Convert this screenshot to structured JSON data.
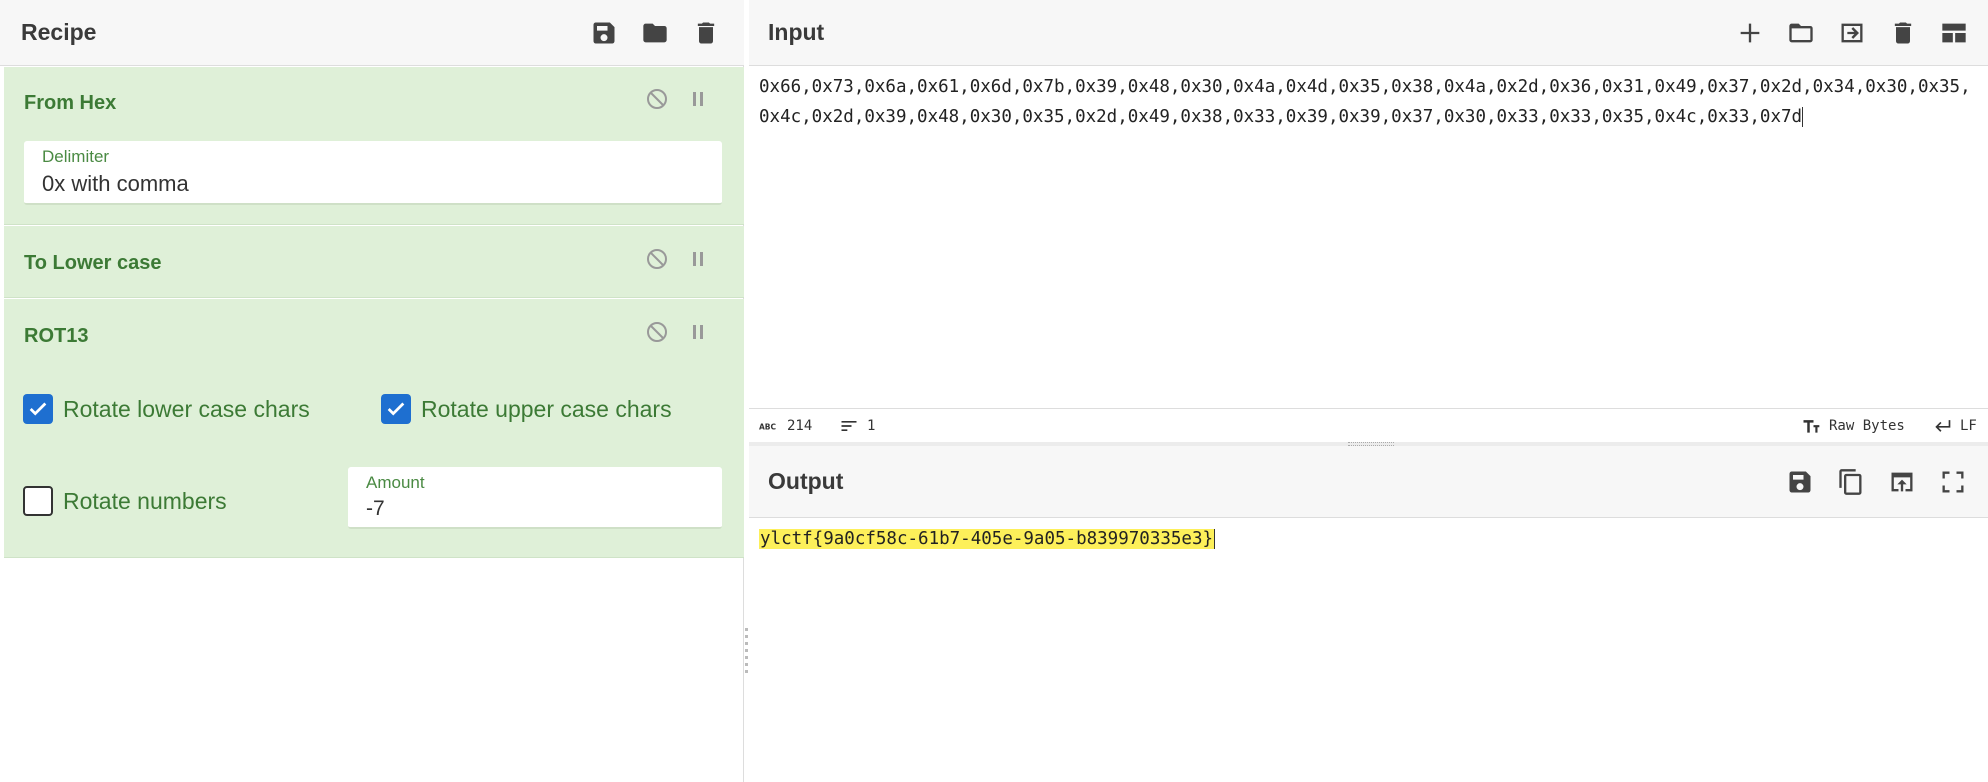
{
  "recipe": {
    "title": "Recipe",
    "icons": [
      "save-icon",
      "folder-icon",
      "trash-icon"
    ],
    "operations": {
      "from_hex": {
        "title": "From Hex",
        "delimiter_label": "Delimiter",
        "delimiter_value": "0x with comma"
      },
      "to_lower": {
        "title": "To Lower case"
      },
      "rot13": {
        "title": "ROT13",
        "rotate_lower_label": "Rotate lower case chars",
        "rotate_lower_checked": true,
        "rotate_upper_label": "Rotate upper case chars",
        "rotate_upper_checked": true,
        "rotate_numbers_label": "Rotate numbers",
        "rotate_numbers_checked": false,
        "amount_label": "Amount",
        "amount_value": "-7"
      }
    }
  },
  "input": {
    "title": "Input",
    "icons": [
      "plus-icon",
      "folder-icon",
      "import-icon",
      "trash-icon",
      "layout-icon"
    ],
    "text": "0x66,0x73,0x6a,0x61,0x6d,0x7b,0x39,0x48,0x30,0x4a,0x4d,0x35,0x38,0x4a,0x2d,0x36,0x31,0x49,0x37,0x2d,0x34,0x30,0x35,0x4c,0x2d,0x39,0x48,0x30,0x35,0x2d,0x49,0x38,0x33,0x39,0x39,0x37,0x30,0x33,0x33,0x35,0x4c,0x33,0x7d",
    "status": {
      "length": "214",
      "lines": "1",
      "encoding": "Raw Bytes",
      "eol": "LF"
    }
  },
  "output": {
    "title": "Output",
    "icons": [
      "save-icon",
      "copy-icon",
      "open-in-input-icon",
      "fullscreen-icon"
    ],
    "text": "ylctf{9a0cf58c-61b7-405e-9a05-b839970335e3}"
  },
  "colors": {
    "operation_bg": "#dff0d8",
    "operation_text": "#3c7a35",
    "checkbox_on": "#1e6fd0",
    "highlight": "#fdf05a"
  }
}
